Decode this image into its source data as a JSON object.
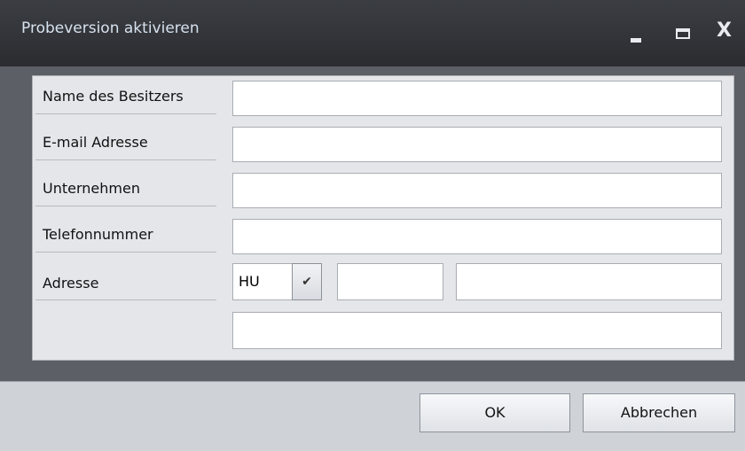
{
  "window": {
    "title": "Probeversion aktivieren"
  },
  "form": {
    "labels": {
      "owner": "Name des Besitzers",
      "email": "E-mail Adresse",
      "company": "Unternehmen",
      "phone": "Telefonnummer",
      "address": "Adresse"
    },
    "values": {
      "owner": "",
      "email": "",
      "company": "",
      "phone": "",
      "postal_code": "",
      "city": "",
      "street": ""
    },
    "country_selected": "HU"
  },
  "buttons": {
    "ok": "OK",
    "cancel": "Abbrechen"
  },
  "icons": {
    "minimize": "minimize-icon",
    "maximize": "maximize-icon",
    "close": "close-icon",
    "dropdown": "chevron-down-icon"
  }
}
